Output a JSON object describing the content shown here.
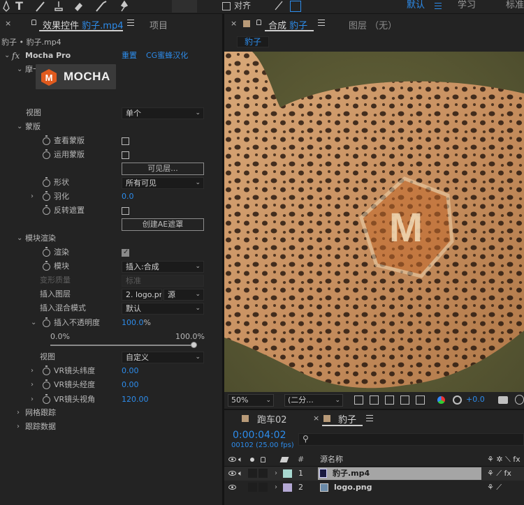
{
  "toolbar": {
    "tools": [
      "pen-tool",
      "type-tool",
      "brush-tool",
      "clone-stamp-tool",
      "eraser-tool",
      "roto-brush-tool",
      "puppet-pin-tool"
    ],
    "snap_label": "对齐",
    "workspaces": [
      "默认",
      "学习",
      "标准"
    ]
  },
  "effects_panel": {
    "tab_label": "效果控件",
    "tab_file": "豹子.mp4",
    "project_tab": "项目",
    "breadcrumb": "豹子 • 豹子.mp4",
    "fx_badge": "fx",
    "effect_name": "Mocha Pro",
    "reset_label": "重置",
    "localize_link": "CG蜜蜂汉化",
    "subhead": "摩卡- Mocha Pro",
    "logo_text": "MOCHA",
    "rows": {
      "view_label": "视图",
      "view_value": "单个",
      "mask_group": "蒙版",
      "view_mask": "查看蒙版",
      "apply_mask": "运用蒙版",
      "visible_layers_btn": "可见层...",
      "shape_label": "形状",
      "shape_value": "所有可见",
      "feather_label": "羽化",
      "feather_value": "0.0",
      "invert_label": "反转遮置",
      "create_ae_mask_btn": "创建AE遮罩",
      "module_group": "模块渲染",
      "render_label": "渲染",
      "module_label": "模块",
      "module_value": "插入:合成",
      "warp_quality_label": "变形质量",
      "warp_quality_value": "标准",
      "insert_layer_label": "插入图层",
      "insert_layer_value": "2. logo.png",
      "insert_layer_source": "源",
      "insert_blend_label": "插入混合模式",
      "insert_blend_value": "默认",
      "insert_opacity_label": "插入不透明度",
      "insert_opacity_value": "100.0",
      "insert_opacity_unit": "%",
      "slider_min": "0.0%",
      "slider_max": "100.0%",
      "slider_level": 1.0,
      "view2_label": "视图",
      "view2_value": "自定义",
      "vr_lat_label": "VR镜头纬度",
      "vr_lat_value": "0.00",
      "vr_lon_label": "VR镜头经度",
      "vr_lon_value": "0.00",
      "vr_fov_label": "VR镜头视角",
      "vr_fov_value": "120.00",
      "mesh_tracking": "网格跟踪",
      "tracking_data": "跟踪数据"
    }
  },
  "composition": {
    "tab_prefix": "合成",
    "tab_name": "豹子",
    "layer_tab": "图层 （无）",
    "crumb": "豹子",
    "zoom": "50%",
    "resolution": "(二分...",
    "exposure": "+0.0"
  },
  "timeline": {
    "tab_other": "跑车02",
    "tab_active": "豹子",
    "timecode": "0:00:04:02",
    "frame_info": "00102 (25.00 fps)",
    "search_icon": "search-icon",
    "col_number": "#",
    "col_source": "源名称",
    "layers": [
      {
        "index": "1",
        "name": "豹子.mp4",
        "color": "#a8d8d0"
      },
      {
        "index": "2",
        "name": "logo.png",
        "color": "#b4a8d4"
      }
    ]
  }
}
